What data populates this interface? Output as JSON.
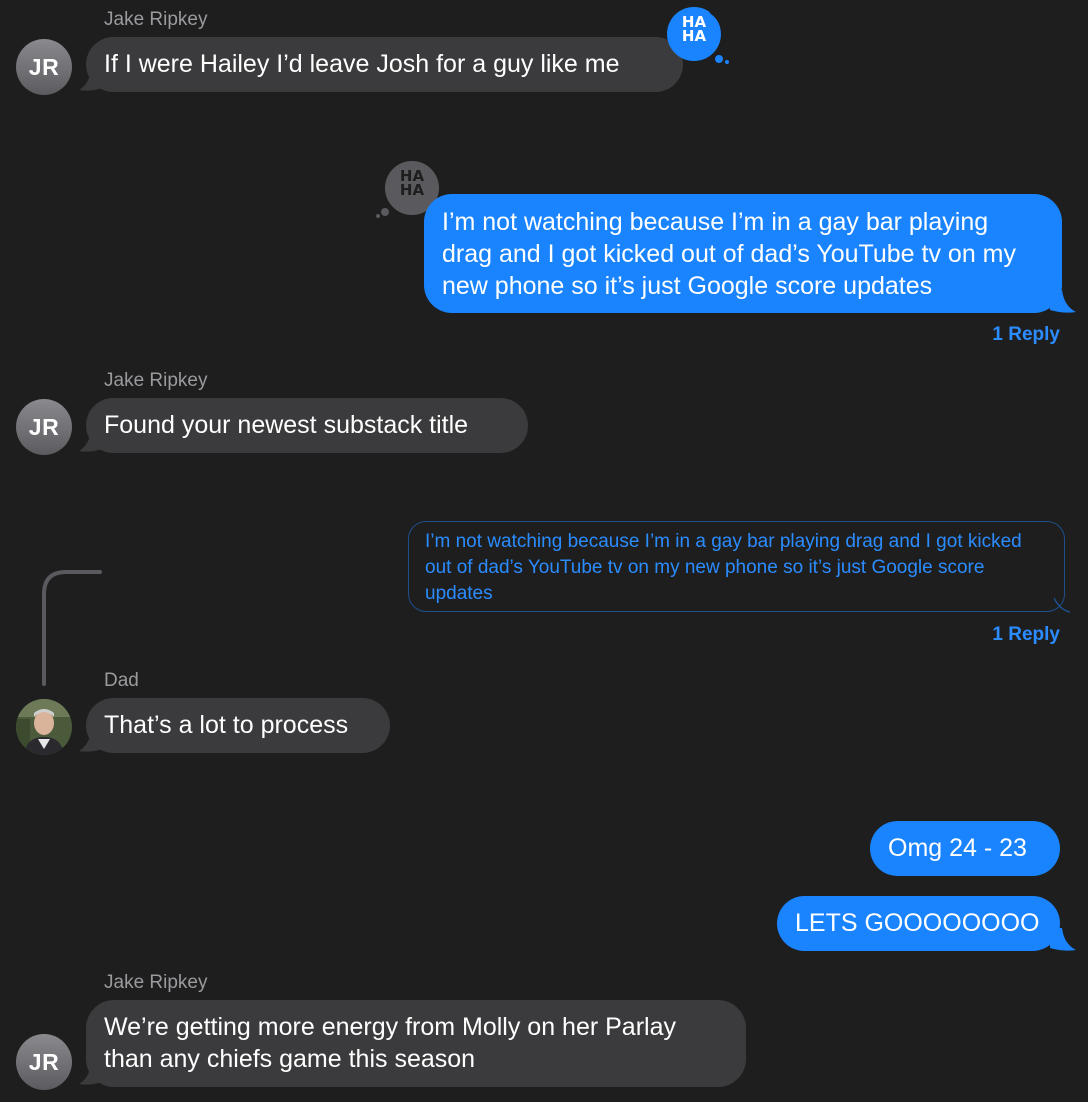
{
  "messages": [
    {
      "sender": "Jake Ripkey",
      "initials": "JR",
      "text": "If I were Hailey I’d leave Josh for a guy like me",
      "tapback": "HA HA"
    },
    {
      "sender": "me",
      "text": "I’m not watching because I’m in a gay bar playing drag and I got kicked out of dad’s YouTube tv on my new phone so it’s just Google score updates",
      "tapback": "HA HA",
      "reply_count": "1 Reply"
    },
    {
      "sender": "Jake Ripkey",
      "initials": "JR",
      "text": "Found your newest substack title"
    },
    {
      "quoted_text": "I’m not watching because I’m in a gay bar playing drag and I got kicked out of dad’s YouTube tv on my new phone so it’s just Google score updates",
      "reply_count": "1 Reply"
    },
    {
      "sender": "Dad",
      "text": "That’s a lot to process"
    },
    {
      "sender": "me",
      "text": "Omg 24 - 23"
    },
    {
      "sender": "me",
      "text": "LETS GOOOOOOOO"
    },
    {
      "sender": "Jake Ripkey",
      "initials": "JR",
      "text": "We’re getting more energy from Molly on her Parlay than any chiefs game this season"
    }
  ],
  "colors": {
    "background": "#1e1e1e",
    "incoming_bubble": "#3b3b3d",
    "outgoing_bubble": "#1a84ff",
    "link_blue": "#2b8cff",
    "sender_gray": "#9b9b9f"
  }
}
